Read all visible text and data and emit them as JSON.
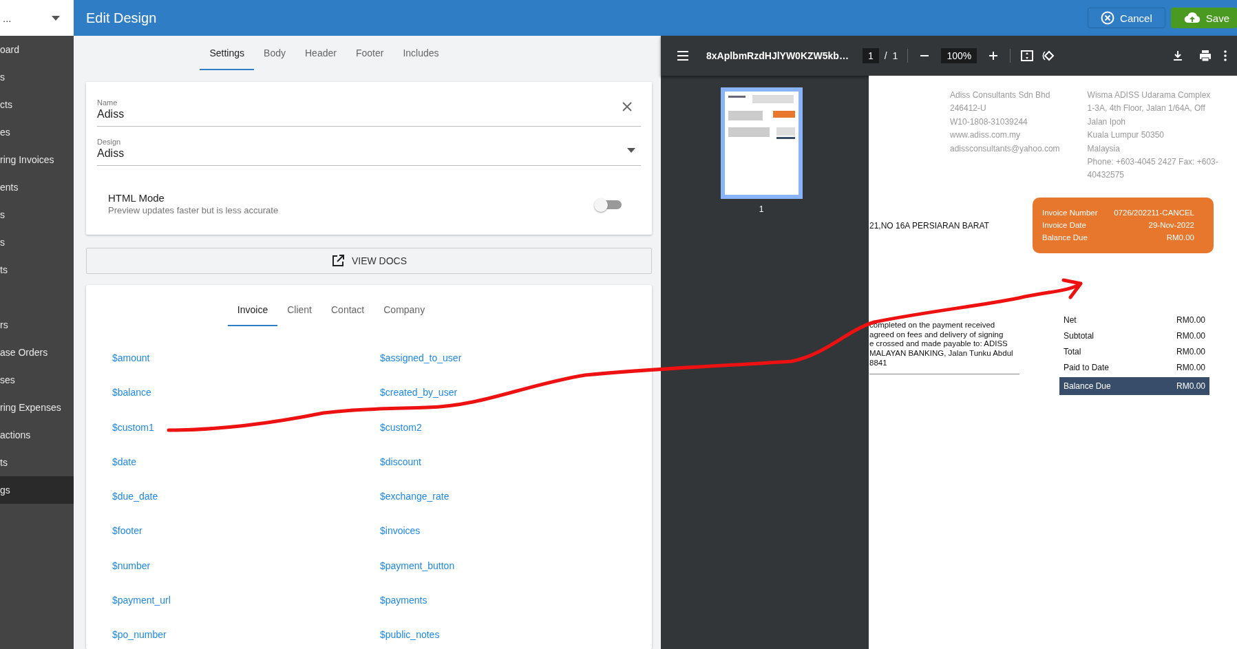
{
  "sidebar": {
    "selector": "...",
    "items": [
      {
        "label": "oard",
        "selected": false
      },
      {
        "label": "s",
        "selected": false
      },
      {
        "label": "cts",
        "selected": false
      },
      {
        "label": "es",
        "selected": false
      },
      {
        "label": "ring Invoices",
        "selected": false
      },
      {
        "label": "ents",
        "selected": false
      },
      {
        "label": "s",
        "selected": false
      },
      {
        "label": "s",
        "selected": false
      },
      {
        "label": "ts",
        "selected": false
      },
      {
        "label": "rs",
        "selected": false,
        "gap_before": true
      },
      {
        "label": "ase Orders",
        "selected": false
      },
      {
        "label": "ses",
        "selected": false
      },
      {
        "label": "ring Expenses",
        "selected": false
      },
      {
        "label": "actions",
        "selected": false
      },
      {
        "label": "ts",
        "selected": false
      },
      {
        "label": "gs",
        "selected": true
      }
    ]
  },
  "header": {
    "title": "Edit Design",
    "buttons": [
      {
        "label": "Cancel",
        "kind": "cancel"
      },
      {
        "label": "Save",
        "kind": "save"
      }
    ]
  },
  "editor": {
    "tabs": [
      {
        "label": "Settings",
        "selected": true
      },
      {
        "label": "Body",
        "selected": false
      },
      {
        "label": "Header",
        "selected": false
      },
      {
        "label": "Footer",
        "selected": false
      },
      {
        "label": "Includes",
        "selected": false
      }
    ],
    "name_field": {
      "label": "Name",
      "value": "Adiss"
    },
    "design_field": {
      "label": "Design",
      "value": "Adiss"
    },
    "html_mode": {
      "label": "HTML Mode",
      "description": "Preview updates faster but is less accurate",
      "on": false
    },
    "view_docs": "VIEW DOCS",
    "variable_tabs": [
      {
        "label": "Invoice",
        "selected": true
      },
      {
        "label": "Client",
        "selected": false
      },
      {
        "label": "Contact",
        "selected": false
      },
      {
        "label": "Company",
        "selected": false
      }
    ],
    "variables": [
      [
        "$amount",
        "$assigned_to_user"
      ],
      [
        "$balance",
        "$created_by_user"
      ],
      [
        "$custom1",
        "$custom2"
      ],
      [
        "$date",
        "$discount"
      ],
      [
        "$due_date",
        "$exchange_rate"
      ],
      [
        "$footer",
        "$invoices"
      ],
      [
        "$number",
        "$payment_button"
      ],
      [
        "$payment_url",
        "$payments"
      ],
      [
        "$po_number",
        "$public_notes"
      ]
    ]
  },
  "preview": {
    "file_name": "8xAplbmRzdHJlYW0KZW5kb…",
    "page": "1",
    "page_separator": "/",
    "page_count": "1",
    "zoom": "100%",
    "thumbnail_label": "1",
    "company": [
      "Adiss Consultants Sdn Bhd",
      "246412-U",
      "W10-1808-31039244",
      "www.adiss.com.my",
      "adissconsultants@yahoo.com"
    ],
    "address": [
      "Wisma ADISS Udarama Complex",
      "1-3A, 4th Floor, Jalan 1/64A, Off",
      "Jalan Ipoh",
      "Kuala Lumpur 50350",
      "Malaysia",
      "Phone: +603-4045 2427 Fax: +603-",
      "40432575"
    ],
    "client_line": "21,NO 16A PERSIARAN BARAT",
    "invoice_box": [
      {
        "label": "Invoice Number",
        "value": "0726/202211-CANCEL"
      },
      {
        "label": "Invoice Date",
        "value": "29-Nov-2022"
      },
      {
        "label": "Balance Due",
        "value": "RM0.00"
      }
    ],
    "terms": [
      "completed on the payment received",
      "agreed on fees and delivery of signing",
      "e crossed and made payable to: ADISS",
      "MALAYAN BANKING, Jalan Tunku Abdul",
      "8841"
    ],
    "totals": [
      {
        "label": "Net",
        "value": "RM0.00",
        "highlight": false
      },
      {
        "label": "Subtotal",
        "value": "RM0.00",
        "highlight": false
      },
      {
        "label": "Total",
        "value": "RM0.00",
        "highlight": false
      },
      {
        "label": "Paid to Date",
        "value": "RM0.00",
        "highlight": false
      },
      {
        "label": "Balance Due",
        "value": "RM0.00",
        "highlight": true
      }
    ]
  }
}
